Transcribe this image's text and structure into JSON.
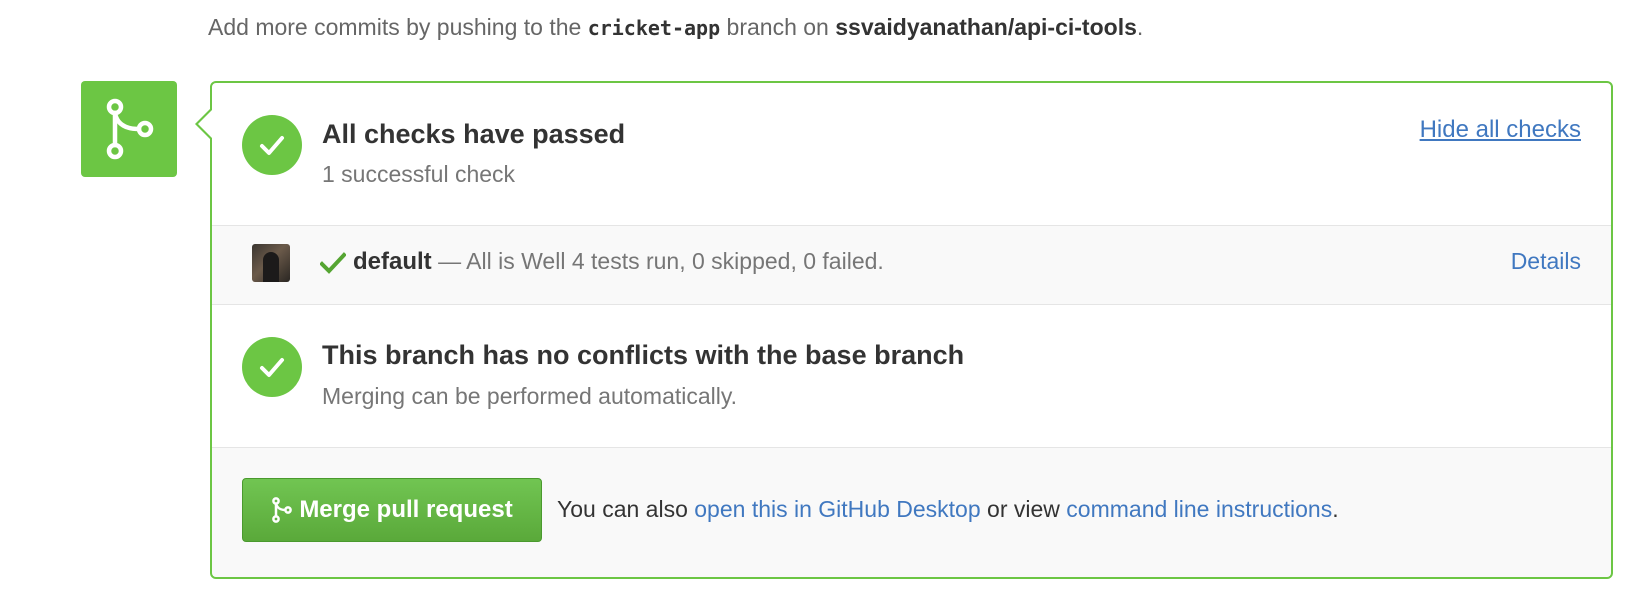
{
  "hint": {
    "prefix": "Add more commits by pushing to the ",
    "branch": "cricket-app",
    "middle": " branch on ",
    "repo": "ssvaidyanathan/api-ci-tools",
    "suffix": "."
  },
  "checks": {
    "title": "All checks have passed",
    "subtitle": "1 successful check",
    "toggle_label": "Hide all checks",
    "items": [
      {
        "context": "default",
        "description": "— All is Well 4 tests run, 0 skipped, 0 failed.",
        "details_label": "Details"
      }
    ]
  },
  "branch_status": {
    "title": "This branch has no conflicts with the base branch",
    "subtitle": "Merging can be performed automatically."
  },
  "merge": {
    "button_label": "Merge pull request",
    "text_prefix": "You can also ",
    "desktop_link": "open this in GitHub Desktop",
    "text_middle": " or view ",
    "cli_link": "command line instructions",
    "text_suffix": "."
  },
  "colors": {
    "success": "#6cc644",
    "link": "#4078c0"
  },
  "icons": {
    "status": "git-merge-icon",
    "check": "check-icon"
  }
}
